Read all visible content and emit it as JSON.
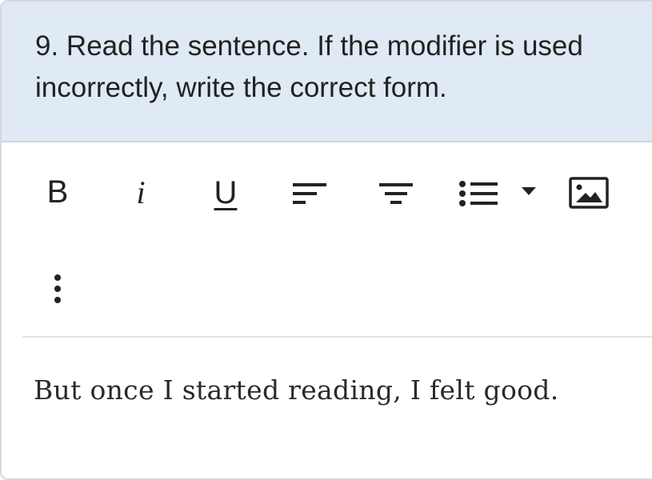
{
  "question": {
    "number": "9.",
    "text": "9.  Read the sentence. If the modifier is used incorrectly, write the correct form."
  },
  "toolbar": {
    "bold_label": "B",
    "italic_label": "i",
    "underline_label": "U",
    "icons": [
      "align-left-icon",
      "align-center-icon",
      "bulleted-list-icon",
      "dropdown-arrow-icon",
      "insert-image-icon",
      "more-options-icon"
    ]
  },
  "answer": {
    "text": "But once I started reading, I felt good."
  },
  "colors": {
    "header_bg": "#dfeaf4",
    "text": "#222222",
    "border": "#d5d8dc"
  }
}
